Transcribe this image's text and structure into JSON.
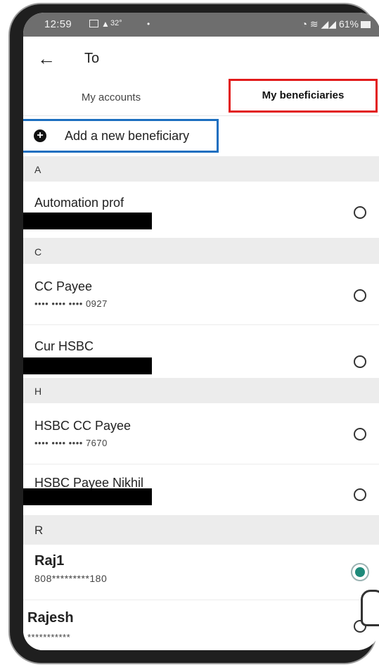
{
  "status_bar": {
    "time": "12:59",
    "temperature": "32°",
    "dot": "•",
    "right": "61%"
  },
  "header": {
    "back_icon": "arrow-left-icon",
    "title": "To"
  },
  "tabs": [
    {
      "label": "My accounts",
      "selected": false
    },
    {
      "label": "My beneficiaries",
      "selected": true
    }
  ],
  "add_new": {
    "icon": "plus-circle-icon",
    "label": "Add a new beneficiary"
  },
  "sections": [
    {
      "letter": "A"
    },
    {
      "letter": "C"
    },
    {
      "letter": "H"
    },
    {
      "letter": "R"
    }
  ],
  "beneficiaries": [
    {
      "name": "Automation prof",
      "detail": "",
      "selected": false
    },
    {
      "name": "CC Payee",
      "detail": "•••• •••• •••• 0927",
      "selected": false
    },
    {
      "name": "Cur HSBC",
      "detail": "",
      "selected": false
    },
    {
      "name": "HSBC CC Payee",
      "detail": "•••• •••• •••• 7670",
      "selected": false
    },
    {
      "name": "HSBC Payee Nikhil",
      "detail": "",
      "selected": false
    },
    {
      "name": "Raj1",
      "detail": "808*********180",
      "selected": true
    },
    {
      "name": "Rajesh",
      "detail": "***********",
      "selected": false
    }
  ],
  "colors": {
    "tab_highlight": "#e21b1b",
    "add_highlight": "#1c6fc0",
    "radio_selected": "#1e8a7a"
  }
}
